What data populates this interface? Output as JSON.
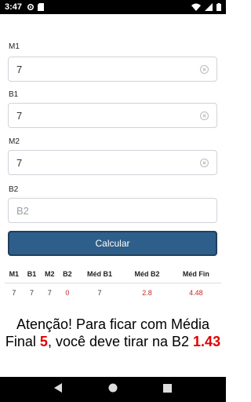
{
  "status": {
    "time": "3:47"
  },
  "fields": [
    {
      "label": "M1",
      "value": "7",
      "placeholder": ""
    },
    {
      "label": "B1",
      "value": "7",
      "placeholder": ""
    },
    {
      "label": "M2",
      "value": "7",
      "placeholder": ""
    },
    {
      "label": "B2",
      "value": "",
      "placeholder": "B2"
    }
  ],
  "button": {
    "label": "Calcular"
  },
  "table": {
    "headers": [
      "M1",
      "B1",
      "M2",
      "B2",
      "Méd B1",
      "Méd B2",
      "Méd Fin"
    ],
    "row": [
      "7",
      "7",
      "7",
      "0",
      "7",
      "2.8",
      "4.48"
    ]
  },
  "message": {
    "part1": "Atenção! Para ficar com Média Final ",
    "target": "5",
    "part2": ", você deve tirar na B2 ",
    "required": "1.43"
  },
  "colors": {
    "button": "#2e5f8a",
    "highlight": "#e00000",
    "value_red": "#c62828"
  }
}
